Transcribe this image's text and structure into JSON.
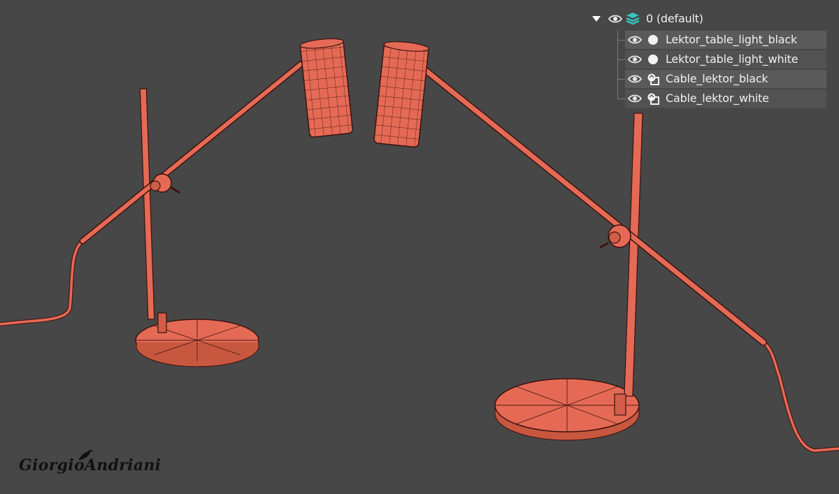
{
  "layers": {
    "root": {
      "label": "0 (default)",
      "expand_icon": "triangle-down-icon",
      "visibility_icon": "eye-icon",
      "type_icon": "layer-stack-icon"
    },
    "children": [
      {
        "label": "Lektor_table_light_black",
        "visibility_icon": "eye-icon",
        "type_icon": "geometry-sphere-icon"
      },
      {
        "label": "Lektor_table_light_white",
        "visibility_icon": "eye-icon",
        "type_icon": "geometry-sphere-icon"
      },
      {
        "label": "Cable_lektor_black",
        "visibility_icon": "eye-icon",
        "type_icon": "shape-spline-icon"
      },
      {
        "label": "Cable_lektor_white",
        "visibility_icon": "eye-icon",
        "type_icon": "shape-spline-icon"
      }
    ]
  },
  "watermark": {
    "signature": "GiorgioAndriani"
  },
  "colors": {
    "viewport_bg": "#474747",
    "wireframe_fill": "#e56a55",
    "wire_edge": "#4a1a14",
    "layer_icon": "#39c4c0",
    "text": "#f0f0f0"
  }
}
